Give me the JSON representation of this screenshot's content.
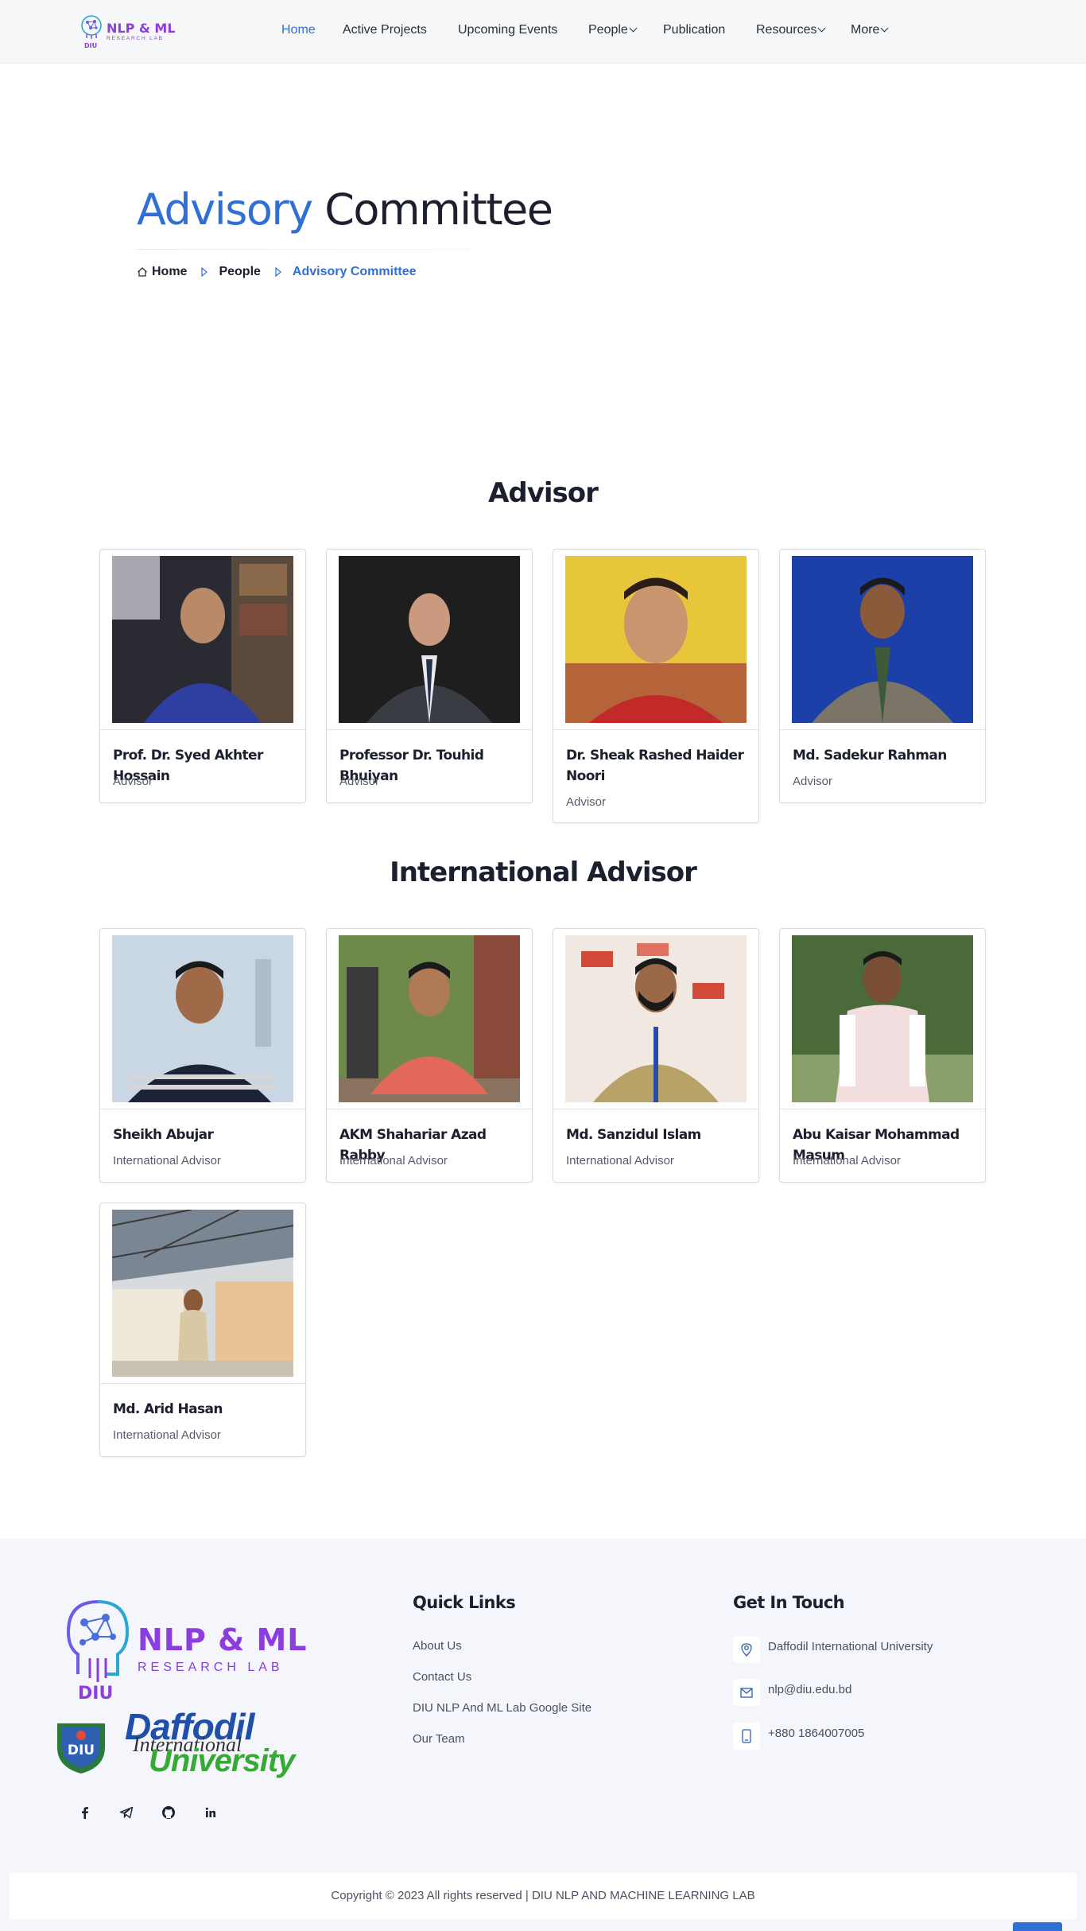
{
  "header": {
    "logo": {
      "line1": "NLP & ML",
      "line2": "RESEARCH LAB",
      "diu": "DIU"
    },
    "nav": [
      {
        "label": "Home",
        "active": true
      },
      {
        "label": "Active Projects"
      },
      {
        "label": "Upcoming Events"
      },
      {
        "label": "People",
        "dropdown": true
      },
      {
        "label": "Publication"
      },
      {
        "label": "Resources",
        "dropdown": true
      },
      {
        "label": "More",
        "dropdown": true
      }
    ]
  },
  "page": {
    "title_accent": "Advisory",
    "title_rest": " Committee",
    "breadcrumb": {
      "home": "Home",
      "people": "People",
      "current": "Advisory Committee"
    }
  },
  "advisors": {
    "heading": "Advisor",
    "members": [
      {
        "name": "Prof. Dr. Syed Akhter Hossain",
        "role": "Advisor"
      },
      {
        "name": "Professor Dr. Touhid Bhuiyan",
        "role": "Advisor"
      },
      {
        "name": "Dr. Sheak Rashed Haider Noori",
        "role": "Advisor"
      },
      {
        "name": "Md. Sadekur Rahman",
        "role": "Advisor"
      }
    ]
  },
  "international": {
    "heading": "International Advisor",
    "members": [
      {
        "name": "Sheikh Abujar",
        "role": "International Advisor"
      },
      {
        "name": "AKM Shahariar Azad Rabby",
        "role": "International Advisor"
      },
      {
        "name": "Md. Sanzidul Islam",
        "role": "International Advisor"
      },
      {
        "name": "Abu Kaisar Mohammad Masum",
        "role": "International Advisor"
      },
      {
        "name": "Md. Arid Hasan",
        "role": "International Advisor"
      }
    ]
  },
  "footer": {
    "logo": {
      "line1": "NLP & ML",
      "line2": "RESEARCH LAB",
      "diu": "DIU"
    },
    "university_logo": {
      "daffodil": "Daffodil",
      "international": "International",
      "university": "University",
      "seal": "DIU"
    },
    "social": [
      "facebook-icon",
      "telegram-icon",
      "github-icon",
      "linkedin-icon"
    ],
    "quick_links": {
      "title": "Quick Links",
      "items": [
        "About Us",
        "Contact Us",
        "DIU NLP And ML Lab Google Site",
        "Our Team"
      ]
    },
    "contact": {
      "title": "Get In Touch",
      "address": "Daffodil International University",
      "email": "nlp@diu.edu.bd",
      "phone": "+880 1864007005"
    },
    "copyright": "Copyright © 2023 All rights reserved | DIU NLP AND MACHINE LEARNING LAB"
  },
  "colors": {
    "accent": "#2f6fd6",
    "brand": "#8b3dde",
    "text": "#1b1f2e",
    "footer_bg": "#f4f6fb"
  }
}
